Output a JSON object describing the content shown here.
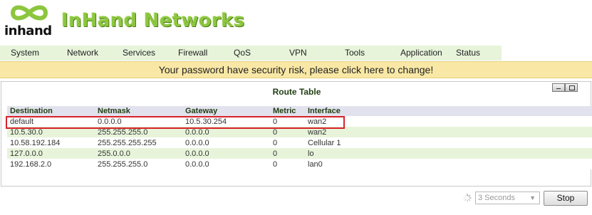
{
  "brand": {
    "logo_text": "inhand",
    "name": "InHand Networks",
    "color": "#8cc63f"
  },
  "nav": {
    "items": [
      {
        "label": "System"
      },
      {
        "label": "Network"
      },
      {
        "label": "Services"
      },
      {
        "label": "Firewall"
      },
      {
        "label": "QoS"
      },
      {
        "label": "VPN"
      },
      {
        "label": "Tools"
      },
      {
        "label": "Application"
      },
      {
        "label": "Status"
      }
    ]
  },
  "banner": {
    "text": "Your password have security risk, please click here to change!"
  },
  "route_table": {
    "title": "Route Table",
    "columns": [
      "Destination",
      "Netmask",
      "Gateway",
      "Metric",
      "Interface"
    ],
    "rows": [
      [
        "default",
        "0.0.0.0",
        "10.5.30.254",
        "0",
        "wan2"
      ],
      [
        "10.5.30.0",
        "255.255.255.0",
        "0.0.0.0",
        "0",
        "wan2"
      ],
      [
        "10.58.192.184",
        "255.255.255.255",
        "0.0.0.0",
        "0",
        "Cellular 1"
      ],
      [
        "127.0.0.0",
        "255.0.0.0",
        "0.0.0.0",
        "0",
        "lo"
      ],
      [
        "192.168.2.0",
        "255.255.255.0",
        "0.0.0.0",
        "0",
        "lan0"
      ]
    ],
    "highlighted_row": "default"
  },
  "controls": {
    "refresh_interval": "3 Seconds",
    "stop_label": "Stop"
  }
}
